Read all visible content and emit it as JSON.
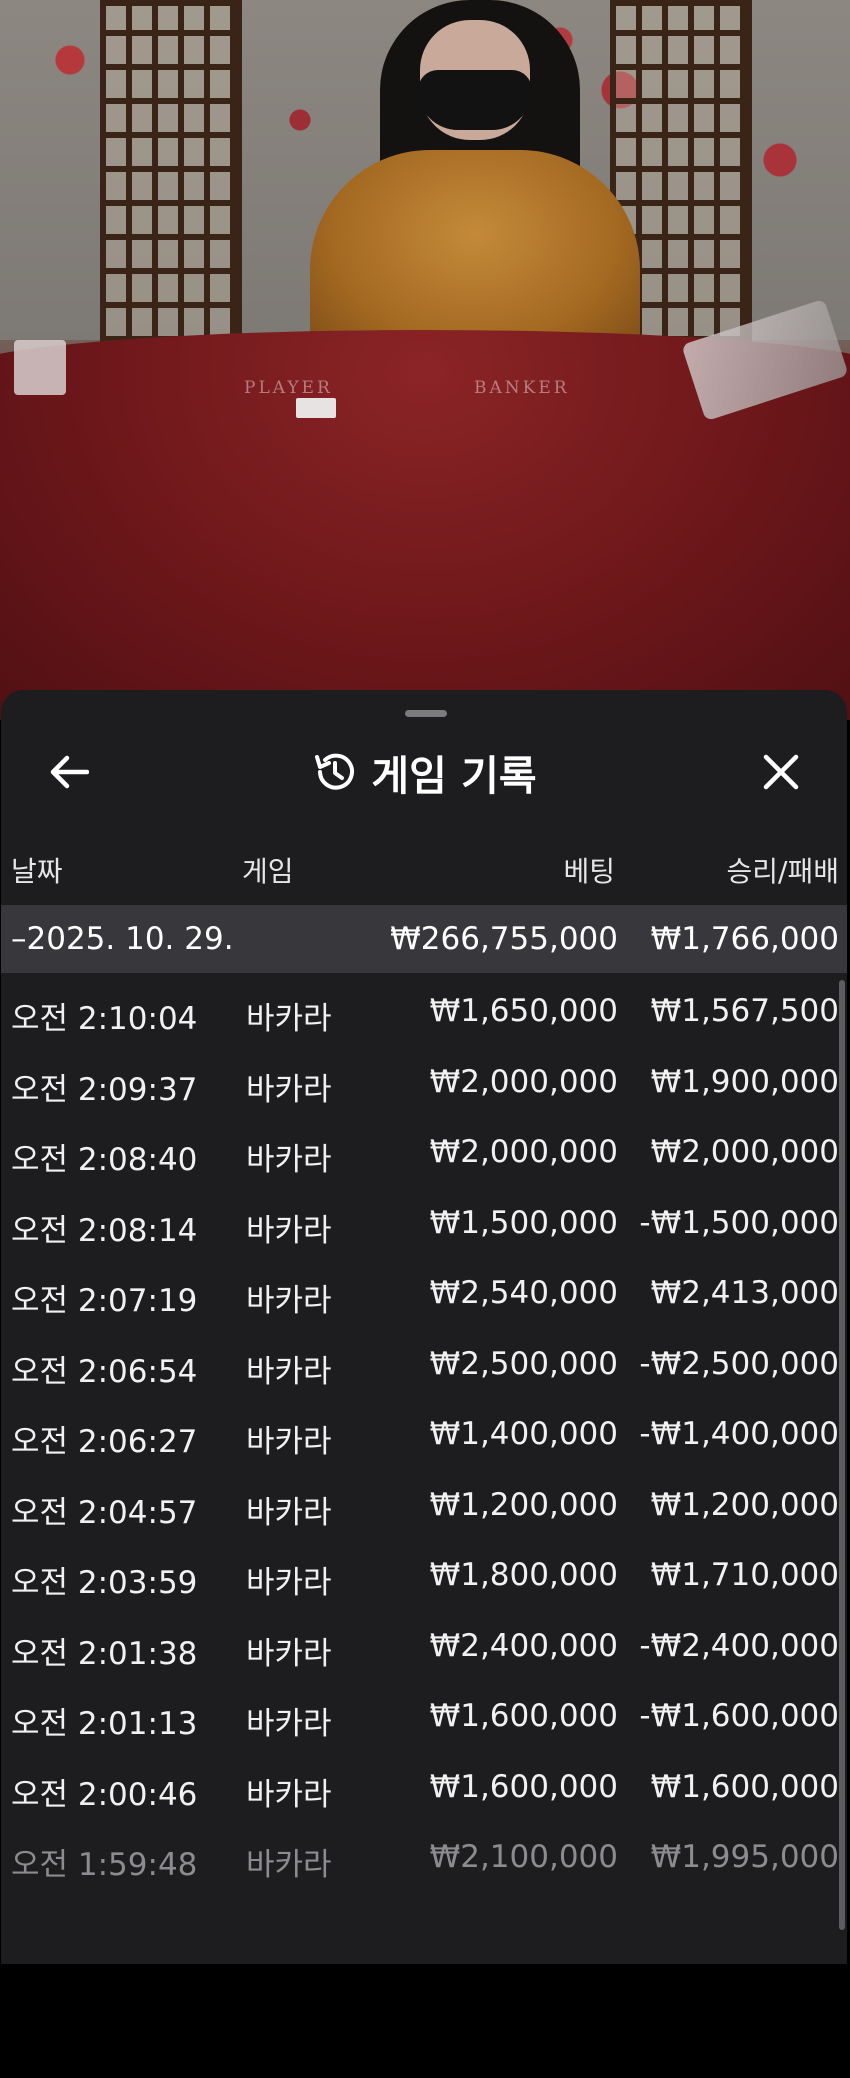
{
  "sheet": {
    "title": "게임 기록",
    "icons": {
      "back": "arrow-left-icon",
      "history": "history-icon",
      "close": "close-icon"
    }
  },
  "table": {
    "columns": {
      "date": "날짜",
      "game": "게임",
      "bet": "베팅",
      "result": "승리/패배"
    },
    "summary": {
      "date": "–2025. 10. 29.",
      "bet": "₩266,755,000",
      "result": "₩1,766,000"
    },
    "rows": [
      {
        "time": "오전 2:10:04",
        "game": "바카라",
        "bet": "₩1,650,000",
        "result": "₩1,567,500"
      },
      {
        "time": "오전 2:09:37",
        "game": "바카라",
        "bet": "₩2,000,000",
        "result": "₩1,900,000"
      },
      {
        "time": "오전 2:08:40",
        "game": "바카라",
        "bet": "₩2,000,000",
        "result": "₩2,000,000"
      },
      {
        "time": "오전 2:08:14",
        "game": "바카라",
        "bet": "₩1,500,000",
        "result": "-₩1,500,000"
      },
      {
        "time": "오전 2:07:19",
        "game": "바카라",
        "bet": "₩2,540,000",
        "result": "₩2,413,000"
      },
      {
        "time": "오전 2:06:54",
        "game": "바카라",
        "bet": "₩2,500,000",
        "result": "-₩2,500,000"
      },
      {
        "time": "오전 2:06:27",
        "game": "바카라",
        "bet": "₩1,400,000",
        "result": "-₩1,400,000"
      },
      {
        "time": "오전 2:04:57",
        "game": "바카라",
        "bet": "₩1,200,000",
        "result": "₩1,200,000"
      },
      {
        "time": "오전 2:03:59",
        "game": "바카라",
        "bet": "₩1,800,000",
        "result": "₩1,710,000"
      },
      {
        "time": "오전 2:01:38",
        "game": "바카라",
        "bet": "₩2,400,000",
        "result": "-₩2,400,000"
      },
      {
        "time": "오전 2:01:13",
        "game": "바카라",
        "bet": "₩1,600,000",
        "result": "-₩1,600,000"
      },
      {
        "time": "오전 2:00:46",
        "game": "바카라",
        "bet": "₩1,600,000",
        "result": "₩1,600,000"
      },
      {
        "time": "오전 1:59:48",
        "game": "바카라",
        "bet": "₩2,100,000",
        "result": "₩1,995,000"
      }
    ]
  },
  "video": {
    "table_labels": {
      "player": "PLAYER",
      "banker": "BANKER"
    }
  }
}
